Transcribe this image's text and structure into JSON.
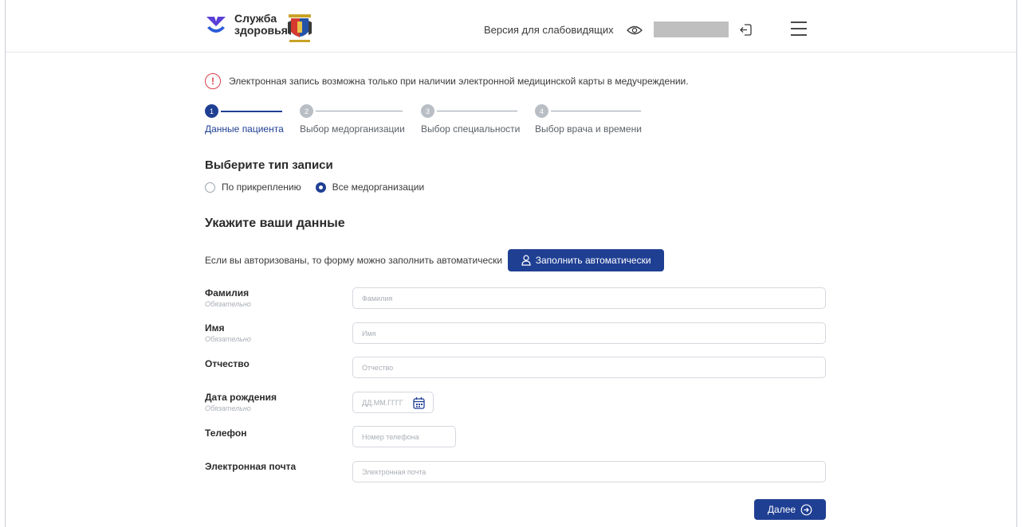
{
  "header": {
    "brand_line1": "Служба",
    "brand_line2": "здоровья",
    "vision_label": "Версия для слабовидящих",
    "icons": [
      "heart-logo-icon",
      "coat-of-arms-icon",
      "eye-icon",
      "logout-icon",
      "menu-icon"
    ]
  },
  "notice": {
    "text": "Электронная запись возможна только при наличии электронной медицинской карты в медучреждении."
  },
  "stepper": {
    "steps": [
      {
        "num": "1",
        "label": "Данные пациента",
        "active": true
      },
      {
        "num": "2",
        "label": "Выбор медорганизации",
        "active": false
      },
      {
        "num": "3",
        "label": "Выбор специальности",
        "active": false
      },
      {
        "num": "4",
        "label": "Выбор врача и времени",
        "active": false
      }
    ]
  },
  "record_type": {
    "title": "Выберите тип записи",
    "options": [
      "По прикреплению",
      "Все медорганизации"
    ],
    "selected": "Все медорганизации"
  },
  "data_section": {
    "title": "Укажите ваши данные",
    "auto_text": "Если вы авторизованы, то форму можно заполнить автоматически",
    "auto_button": "Заполнить автоматически"
  },
  "form": {
    "required_note": "Обязательно",
    "fields": [
      {
        "label": "Фамилия",
        "placeholder": "Фамилия",
        "required": true
      },
      {
        "label": "Имя",
        "placeholder": "Имя",
        "required": true
      },
      {
        "label": "Отчество",
        "placeholder": "Отчество",
        "required": false
      },
      {
        "label": "Дата рождения",
        "placeholder": "ДД.ММ.ГГГГ",
        "required": true
      },
      {
        "label": "Телефон",
        "placeholder": "Номер телефона",
        "required": false
      },
      {
        "label": "Электронная почта",
        "placeholder": "Электронная почта",
        "required": false
      }
    ],
    "next_button": "Далее"
  },
  "colors": {
    "accent": "#1f3f93",
    "logo_purple": "#5b3fd8",
    "logo_blue": "#2b5bd8",
    "alert": "#d8404b"
  }
}
